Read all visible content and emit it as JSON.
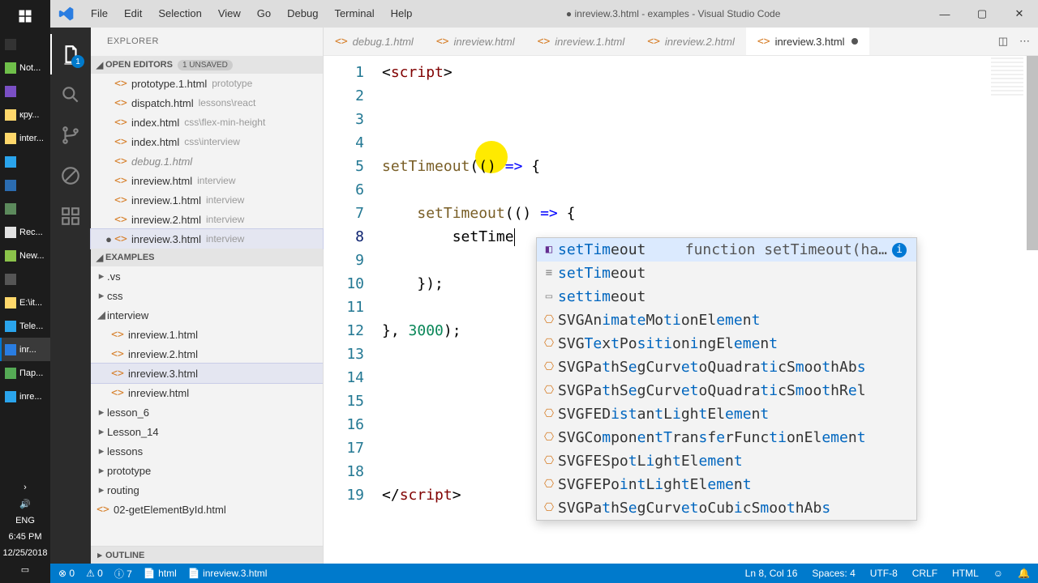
{
  "window": {
    "title_prefix": "●",
    "title": "inreview.3.html - examples - Visual Studio Code"
  },
  "menu": [
    "File",
    "Edit",
    "Selection",
    "View",
    "Go",
    "Debug",
    "Terminal",
    "Help"
  ],
  "activitybar": {
    "badge": "1"
  },
  "sidebar": {
    "title": "EXPLORER",
    "openeditors": {
      "label": "OPEN EDITORS",
      "badge": "1 UNSAVED",
      "items": [
        {
          "name": "prototype.1.html",
          "path": "prototype",
          "dirty": false,
          "dim": false
        },
        {
          "name": "dispatch.html",
          "path": "lessons\\react",
          "dirty": false,
          "dim": false
        },
        {
          "name": "index.html",
          "path": "css\\flex-min-height",
          "dirty": false,
          "dim": false
        },
        {
          "name": "index.html",
          "path": "css\\interview",
          "dirty": false,
          "dim": false
        },
        {
          "name": "debug.1.html",
          "path": "",
          "dirty": false,
          "dim": true
        },
        {
          "name": "inreview.html",
          "path": "interview",
          "dirty": false,
          "dim": false
        },
        {
          "name": "inreview.1.html",
          "path": "interview",
          "dirty": false,
          "dim": false
        },
        {
          "name": "inreview.2.html",
          "path": "interview",
          "dirty": false,
          "dim": false
        },
        {
          "name": "inreview.3.html",
          "path": "interview",
          "dirty": true,
          "dim": false,
          "sel": true
        }
      ]
    },
    "workspace": {
      "label": "EXAMPLES",
      "items": [
        {
          "type": "folder",
          "name": ".vs",
          "expanded": false,
          "indent": 0
        },
        {
          "type": "folder",
          "name": "css",
          "expanded": false,
          "indent": 0
        },
        {
          "type": "folder",
          "name": "interview",
          "expanded": true,
          "indent": 0
        },
        {
          "type": "file",
          "name": "inreview.1.html",
          "indent": 1
        },
        {
          "type": "file",
          "name": "inreview.2.html",
          "indent": 1
        },
        {
          "type": "file",
          "name": "inreview.3.html",
          "indent": 1,
          "sel": true
        },
        {
          "type": "file",
          "name": "inreview.html",
          "indent": 1
        },
        {
          "type": "folder",
          "name": "lesson_6",
          "expanded": false,
          "indent": 0
        },
        {
          "type": "folder",
          "name": "Lesson_14",
          "expanded": false,
          "indent": 0
        },
        {
          "type": "folder",
          "name": "lessons",
          "expanded": false,
          "indent": 0
        },
        {
          "type": "folder",
          "name": "prototype",
          "expanded": false,
          "indent": 0
        },
        {
          "type": "folder",
          "name": "routing",
          "expanded": false,
          "indent": 0
        },
        {
          "type": "file",
          "name": "02-getElementById.html",
          "indent": 0
        }
      ]
    },
    "outline": "OUTLINE"
  },
  "tabs": [
    {
      "name": "debug.1.html",
      "active": false
    },
    {
      "name": "inreview.html",
      "active": false
    },
    {
      "name": "inreview.1.html",
      "active": false
    },
    {
      "name": "inreview.2.html",
      "active": false
    },
    {
      "name": "inreview.3.html",
      "active": true,
      "dirty": true
    }
  ],
  "code": {
    "lines": 19,
    "cursor_line": 8
  },
  "intelli": {
    "doc": "function setTimeout(ha…",
    "items": [
      {
        "pre": "setTim",
        "rest": "eout",
        "kind": "method",
        "sel": true
      },
      {
        "pre": "setTim",
        "rest": "eout",
        "kind": "snippet"
      },
      {
        "pre": "settim",
        "rest": "eout",
        "kind": "keyword"
      },
      {
        "pre": "S",
        "match": "VGAnimateMotionElement",
        "letters": "SVGAnimateMotionElement",
        "kind": "class"
      },
      {
        "pre": "S",
        "match": "VGTextPositioningElement",
        "letters": "SVGTextPositioningElement",
        "kind": "class"
      },
      {
        "pre": "S",
        "match": "VGPathSegCurvetoQuadraticSmoothAbs",
        "letters": "SVGPathSegCurvetoQuadraticSmoothAbs",
        "kind": "class"
      },
      {
        "pre": "S",
        "match": "VGPathSegCurvetoQuadraticSmoothRel",
        "letters": "SVGPathSegCurvetoQuadraticSmoothRel",
        "kind": "class"
      },
      {
        "pre": "S",
        "match": "VGFEDistantLightElement",
        "letters": "SVGFEDistantLightElement",
        "kind": "class"
      },
      {
        "pre": "S",
        "match": "VGComponentTransferFunctionElement",
        "letters": "SVGComponentTransferFunctionElement",
        "kind": "class"
      },
      {
        "pre": "S",
        "match": "VGFESpotLightElement",
        "letters": "SVGFESpotLightElement",
        "kind": "class"
      },
      {
        "pre": "S",
        "match": "VGFEPointLightElement",
        "letters": "SVGFEPointLightElement",
        "kind": "class"
      },
      {
        "pre": "S",
        "match": "VGPathSegCurvetoCubicSmoothAbs",
        "letters": "SVGPathSegCurvetoCubicSmoothAbs",
        "kind": "class"
      }
    ]
  },
  "statusbar": {
    "errors": "⊗ 0",
    "warnings": "⚠ 0",
    "info": "ⓘ 7",
    "lang_left1": "html",
    "lang_left2": "inreview.3.html",
    "cursor": "Ln 8, Col 16",
    "spaces": "Spaces: 4",
    "encoding": "UTF-8",
    "eol": "CRLF",
    "language": "HTML",
    "feedback": "☺"
  },
  "taskbar": {
    "items": [
      {
        "label": "",
        "color": "#333"
      },
      {
        "label": "Not...",
        "color": "#6fbf4a"
      },
      {
        "label": "",
        "color": "#7a4fc4"
      },
      {
        "label": "кру...",
        "color": "#ffd86b"
      },
      {
        "label": "inter...",
        "color": "#ffd86b"
      },
      {
        "label": "",
        "color": "#2aa4ec"
      },
      {
        "label": "",
        "color": "#2b6cb0"
      },
      {
        "label": "",
        "color": "#5c8a5c"
      },
      {
        "label": "Rec...",
        "color": "#e2e2e2"
      },
      {
        "label": "New...",
        "color": "#8bc34a"
      },
      {
        "label": "",
        "color": "#555"
      },
      {
        "label": "E:\\it...",
        "color": "#ffd86b"
      },
      {
        "label": "Tele...",
        "color": "#2aa4ec"
      },
      {
        "label": "inr...",
        "color": "#2a7de1",
        "active": true
      },
      {
        "label": "Пар...",
        "color": "#5a5"
      },
      {
        "label": "inre...",
        "color": "#2aa4ec"
      }
    ],
    "tray": {
      "lang": "ENG",
      "time": "6:45 PM",
      "date": "12/25/2018"
    }
  }
}
